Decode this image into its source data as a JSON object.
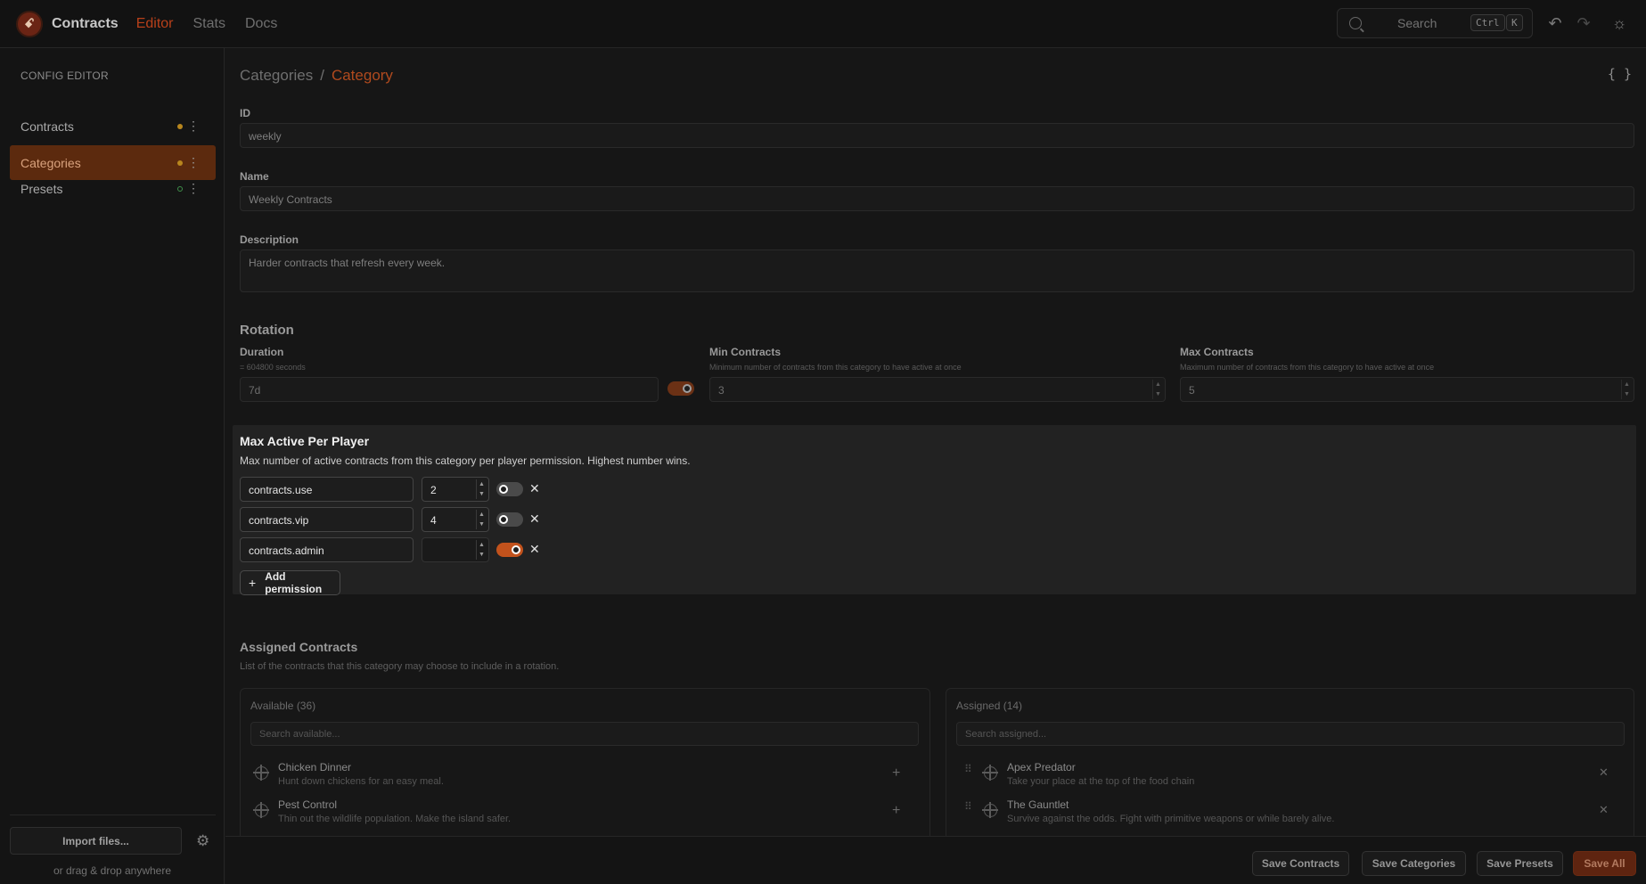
{
  "header": {
    "brand": "Contracts",
    "logo_glyph": "ꗃ",
    "nav": [
      {
        "label": "Editor",
        "active": true
      },
      {
        "label": "Stats",
        "active": false
      },
      {
        "label": "Docs",
        "active": false
      }
    ],
    "search_label": "Search",
    "shortcut": [
      "Ctrl",
      "K"
    ],
    "icons": [
      "search-icon",
      "undo-icon",
      "redo-icon",
      "sun-icon"
    ]
  },
  "sidebar": {
    "title": "CONFIG EDITOR",
    "items": [
      {
        "label": "Contracts",
        "active": false,
        "dot_color": "#b8861e"
      },
      {
        "label": "Categories",
        "active": true,
        "dot_color": "#b8861e"
      },
      {
        "label": "Presets",
        "active": false,
        "dot_color": "#3f8f4a"
      }
    ],
    "import_label": "Import files...",
    "drag_hint": "or drag & drop anywhere"
  },
  "breadcrumb": {
    "parent": "Categories",
    "separator": "/",
    "current": "Category"
  },
  "json_toggle": "{ }",
  "form": {
    "id_label": "ID",
    "id_value": "weekly",
    "name_label": "Name",
    "name_value": "Weekly Contracts",
    "description_label": "Description",
    "description_value": "Harder contracts that refresh every week.",
    "rotation": {
      "title": "Rotation",
      "duration_label": "Duration",
      "duration_hint": "= 604800 seconds",
      "duration_value": "7d",
      "duration_toggle_on": true,
      "min_label": "Min Contracts",
      "min_hint": "Minimum number of contracts from this category to have active at once",
      "min_value": "3",
      "max_label": "Max Contracts",
      "max_hint": "Maximum number of contracts from this category to have active at once",
      "max_value": "5"
    }
  },
  "max_active": {
    "title": "Max Active Per Player",
    "description": "Max number of active contracts from this category per player permission. Highest number wins.",
    "rows": [
      {
        "permission": "contracts.use",
        "value": "2",
        "toggle_on": false
      },
      {
        "permission": "contracts.vip",
        "value": "4",
        "toggle_on": false
      },
      {
        "permission": "contracts.admin",
        "value": "",
        "toggle_on": true
      }
    ],
    "add_label": "Add permission"
  },
  "assigned": {
    "title": "Assigned Contracts",
    "description": "List of the contracts that this category may choose to include in a rotation.",
    "available": {
      "title": "Available (36)",
      "search_placeholder": "Search available...",
      "items": [
        {
          "name": "Chicken Dinner",
          "desc": "Hunt down chickens for an easy meal."
        },
        {
          "name": "Pest Control",
          "desc": "Thin out the wildlife population. Make the island safer."
        }
      ]
    },
    "assigned_list": {
      "title": "Assigned (14)",
      "search_placeholder": "Search assigned...",
      "items": [
        {
          "name": "Apex Predator",
          "desc": "Take your place at the top of the food chain"
        },
        {
          "name": "The Gauntlet",
          "desc": "Survive against the odds. Fight with primitive weapons or while barely alive."
        }
      ]
    }
  },
  "footer": {
    "buttons": [
      "Save Contracts",
      "Save Categories",
      "Save Presets",
      "Save All"
    ]
  }
}
